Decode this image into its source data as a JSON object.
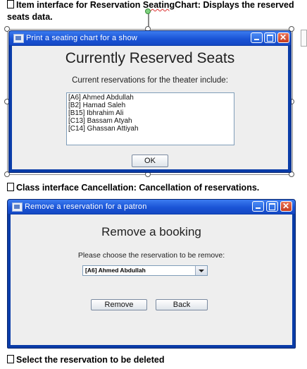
{
  "doc": {
    "line1_a": "Item interface for Reservation S",
    "line1_b": "eating",
    "line1_c": "Chart: Displays the reserved",
    "line1_wrap": "seats data.",
    "line2": "Class interface Cancellation: Cancellation of reservations.",
    "line3": "Select the reservation to be deleted"
  },
  "window1": {
    "title": "Print a seating chart for a show",
    "heading": "Currently Reserved Seats",
    "subheading": "Current reservations for the theater include:",
    "reservations": [
      "[A6] Ahmed Abdullah",
      "[B2] Hamad Saleh",
      "[B15]  Ibhrahim Ali",
      "[C13]  Bassam Atyah",
      "[C14]  Ghassan Attiyah"
    ],
    "ok_label": "OK"
  },
  "window2": {
    "title": "Remove a reservation for a patron",
    "heading": "Remove a booking",
    "prompt": "Please choose the reservation to be remove:",
    "selected_reservation": "[A6] Ahmed Abdullah",
    "remove_label": "Remove",
    "back_label": "Back"
  }
}
